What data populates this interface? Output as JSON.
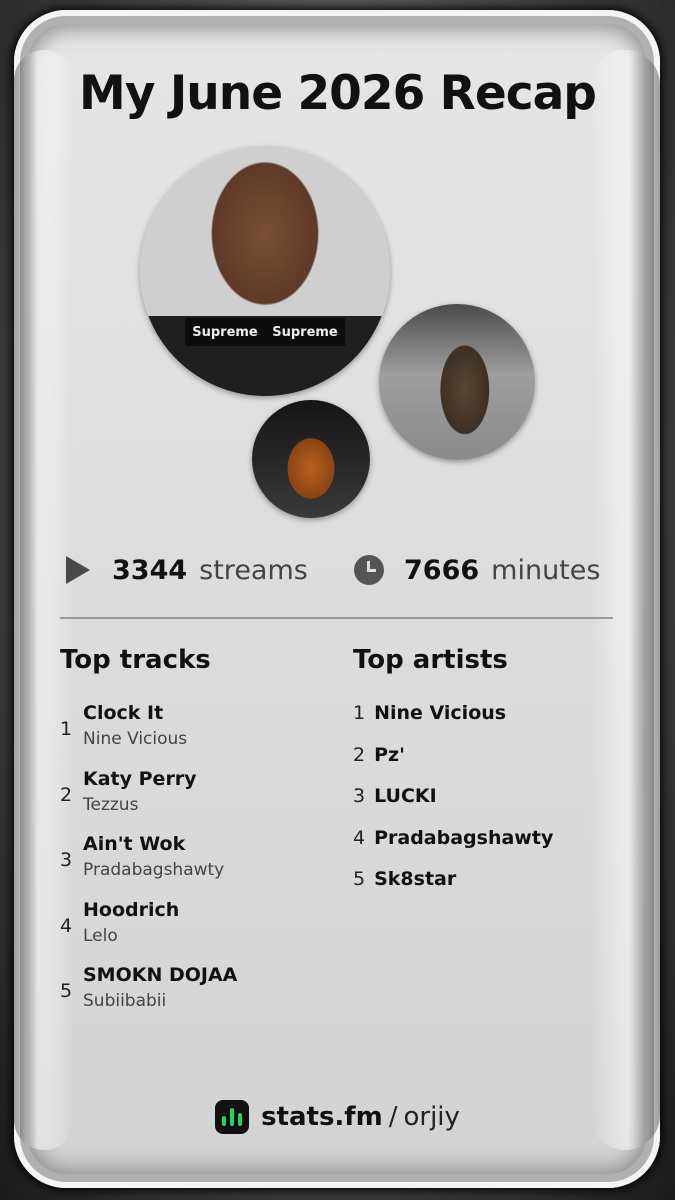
{
  "title": "My June 2026 Recap",
  "photos": {
    "top_artist_label": "Supreme"
  },
  "stats": {
    "streams_value": "3344",
    "streams_label": "streams",
    "minutes_value": "7666",
    "minutes_label": "minutes"
  },
  "top_tracks": {
    "title": "Top tracks",
    "items": [
      {
        "rank": "1",
        "name": "Clock It",
        "artist": "Nine Vicious"
      },
      {
        "rank": "2",
        "name": "Katy Perry",
        "artist": "Tezzus"
      },
      {
        "rank": "3",
        "name": "Ain't Wok",
        "artist": "Pradabagshawty"
      },
      {
        "rank": "4",
        "name": "Hoodrich",
        "artist": "Lelo"
      },
      {
        "rank": "5",
        "name": "SMOKN DOJAA",
        "artist": "Subiibabii"
      }
    ]
  },
  "top_artists": {
    "title": "Top artists",
    "items": [
      {
        "rank": "1",
        "name": "Nine Vicious"
      },
      {
        "rank": "2",
        "name": "Pz'"
      },
      {
        "rank": "3",
        "name": "LUCKI"
      },
      {
        "rank": "4",
        "name": "Pradabagshawty"
      },
      {
        "rank": "5",
        "name": "Sk8star"
      }
    ]
  },
  "footer": {
    "brand": "stats.fm",
    "separator": "/",
    "username": "orjiy",
    "logo_icon": "stats-fm-logo-icon"
  },
  "colors": {
    "accent": "#1ed760",
    "text": "#111111"
  }
}
